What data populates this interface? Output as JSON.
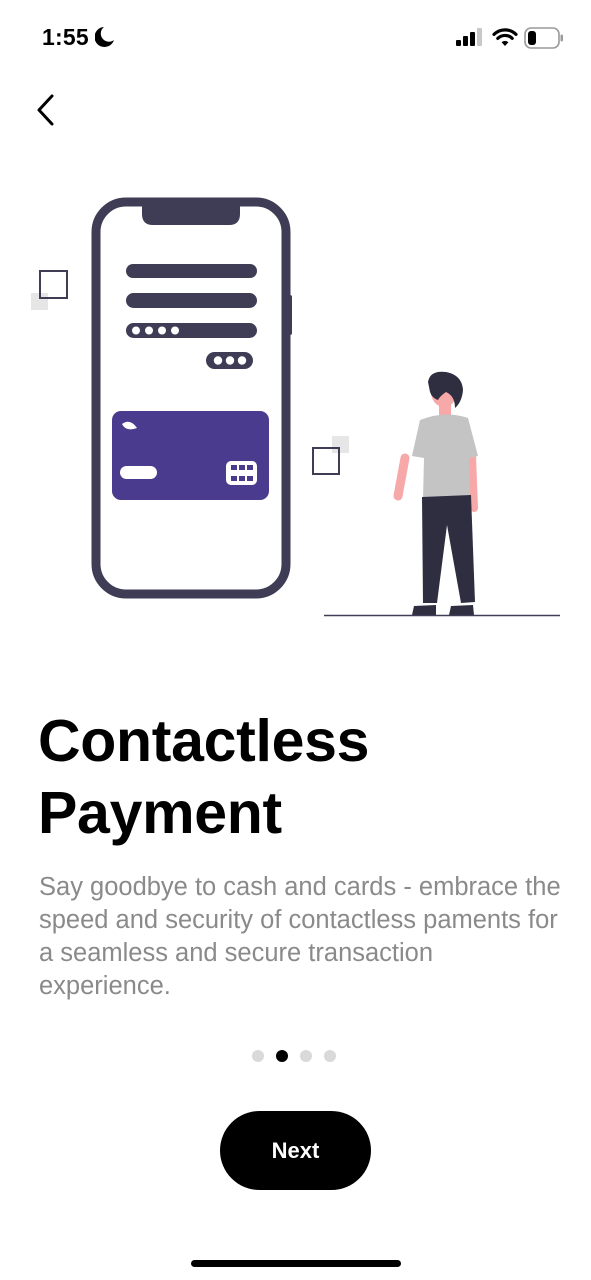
{
  "status_bar": {
    "time": "1:55",
    "icons": [
      "moon-icon",
      "cellular-signal-icon",
      "wifi-icon",
      "battery-icon"
    ]
  },
  "navigation": {
    "back_icon": "chevron-left-icon"
  },
  "illustration": {
    "subject": "phone-with-payment-card-and-person",
    "colors": {
      "dark": "#3f3d56",
      "card": "#4b3b8f",
      "shirt": "#c4c4c4",
      "skin": "#f7a8a8",
      "square_fill": "#e6e6e6"
    }
  },
  "onboarding": {
    "title": "Contactless Payment",
    "description": "Say goodbye to cash and cards - embrace the speed and security of contactless paments for a seamless and secure transaction experience.",
    "page_index": 2,
    "page_count": 4
  },
  "actions": {
    "next_label": "Next"
  },
  "colors": {
    "background": "#ffffff",
    "primary_button": "#000000",
    "description_text": "#8a8a8a",
    "dot_inactive": "#d9d9d9",
    "dot_active": "#000000"
  }
}
